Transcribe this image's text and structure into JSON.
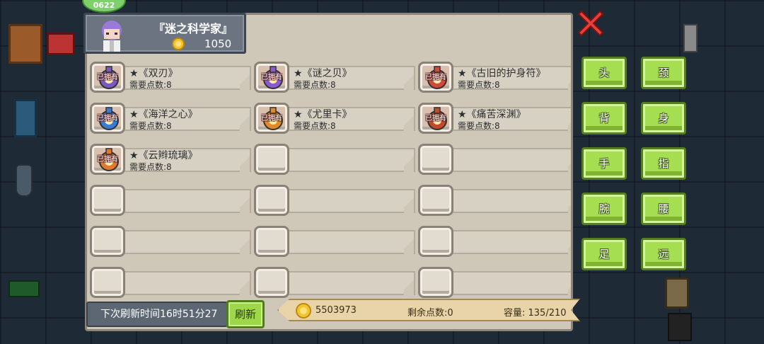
{
  "header": {
    "title": "『迷之科学家』",
    "coins": "1050",
    "bubble_text": "0622"
  },
  "owned_label": "已拥有",
  "items": [
    {
      "name": "★《双刃》",
      "cost": "需要点数:8",
      "owned": true,
      "color": "#7a5ac0"
    },
    {
      "name": "★《谜之贝》",
      "cost": "需要点数:8",
      "owned": true,
      "color": "#8a5ad0"
    },
    {
      "name": "★《古旧的护身符》",
      "cost": "需要点数:8",
      "owned": true,
      "color": "#d04a3a"
    },
    {
      "name": "★《海洋之心》",
      "cost": "需要点数:8",
      "owned": true,
      "color": "#3a7ad0"
    },
    {
      "name": "★《尤里卡》",
      "cost": "需要点数:8",
      "owned": true,
      "color": "#e08a2a"
    },
    {
      "name": "★《痛苦深渊》",
      "cost": "需要点数:8",
      "owned": true,
      "color": "#c04a2a"
    },
    {
      "name": "★《云辫琉璃》",
      "cost": "需要点数:8",
      "owned": true,
      "color": "#e07a2a"
    }
  ],
  "footer": {
    "refresh_time": "下次刷新时间16时51分27",
    "refresh_button": "刷新",
    "gold": "5503973",
    "points_left": "剩余点数:0",
    "capacity": "容量: 135/210"
  },
  "categories": [
    "头",
    "颈",
    "背",
    "身",
    "手",
    "指",
    "腕",
    "腰",
    "足",
    "远"
  ],
  "icons": {
    "coin": "coin-icon",
    "close": "close-icon"
  }
}
